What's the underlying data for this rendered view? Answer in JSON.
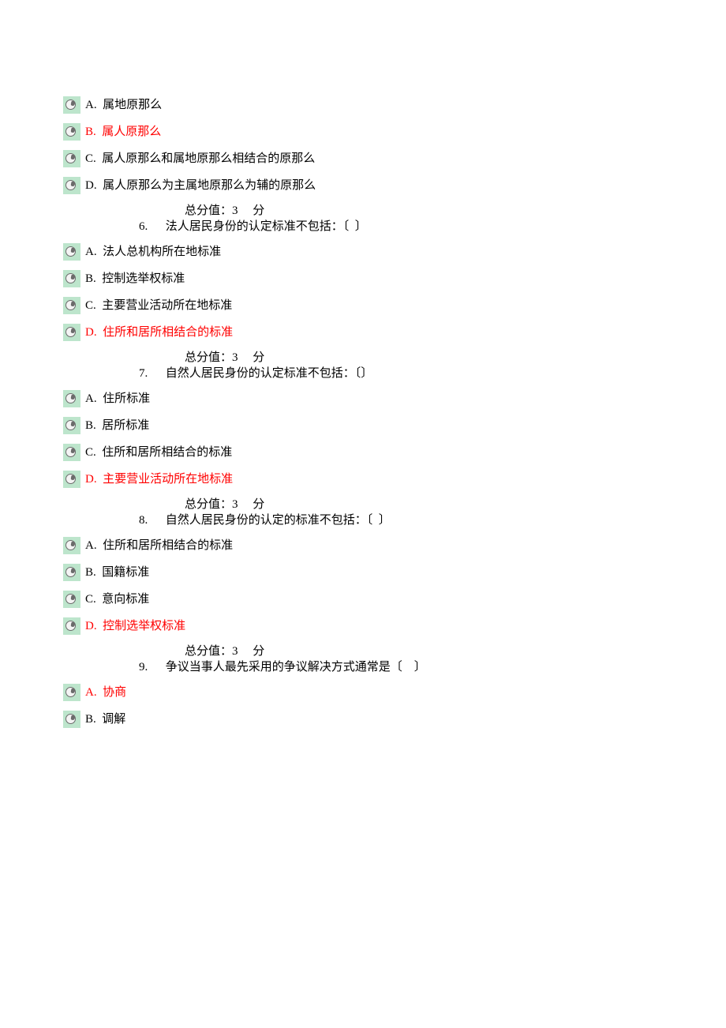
{
  "questions": [
    {
      "number": "",
      "stem": "",
      "score_label": "",
      "options": [
        {
          "label": "A.  属地原那么",
          "correct": false
        },
        {
          "label": "B.  属人原那么",
          "correct": true
        },
        {
          "label": "C.  属人原那么和属地原那么相结合的原那么",
          "correct": false
        },
        {
          "label": "D.  属人原那么为主属地原那么为辅的原那么",
          "correct": false
        }
      ]
    },
    {
      "number": "6.",
      "stem": "法人居民身份的认定标准不包括：〔  〕",
      "score_label": "总分值：3     分",
      "options": [
        {
          "label": "A.  法人总机构所在地标准",
          "correct": false
        },
        {
          "label": "B.  控制选举权标准",
          "correct": false
        },
        {
          "label": "C.  主要营业活动所在地标准",
          "correct": false
        },
        {
          "label": "D.  住所和居所相结合的标准",
          "correct": true
        }
      ]
    },
    {
      "number": "7.",
      "stem": "自然人居民身份的认定标准不包括：〔〕",
      "score_label": "总分值：3     分",
      "options": [
        {
          "label": "A.  住所标准",
          "correct": false
        },
        {
          "label": "B.  居所标准",
          "correct": false
        },
        {
          "label": "C.  住所和居所相结合的标准",
          "correct": false
        },
        {
          "label": "D.  主要营业活动所在地标准",
          "correct": true
        }
      ]
    },
    {
      "number": "8.",
      "stem": "自然人居民身份的认定的标准不包括：〔  〕",
      "score_label": "总分值：3     分",
      "options": [
        {
          "label": "A.  住所和居所相结合的标准",
          "correct": false
        },
        {
          "label": "B.  国籍标准",
          "correct": false
        },
        {
          "label": "C.  意向标准",
          "correct": false
        },
        {
          "label": "D.  控制选举权标准",
          "correct": true
        }
      ]
    },
    {
      "number": "9.",
      "stem": "争议当事人最先采用的争议解决方式通常是〔    〕",
      "score_label": "总分值：3     分",
      "options": [
        {
          "label": "A.  协商",
          "correct": true
        },
        {
          "label": "B.  调解",
          "correct": false
        }
      ]
    }
  ]
}
